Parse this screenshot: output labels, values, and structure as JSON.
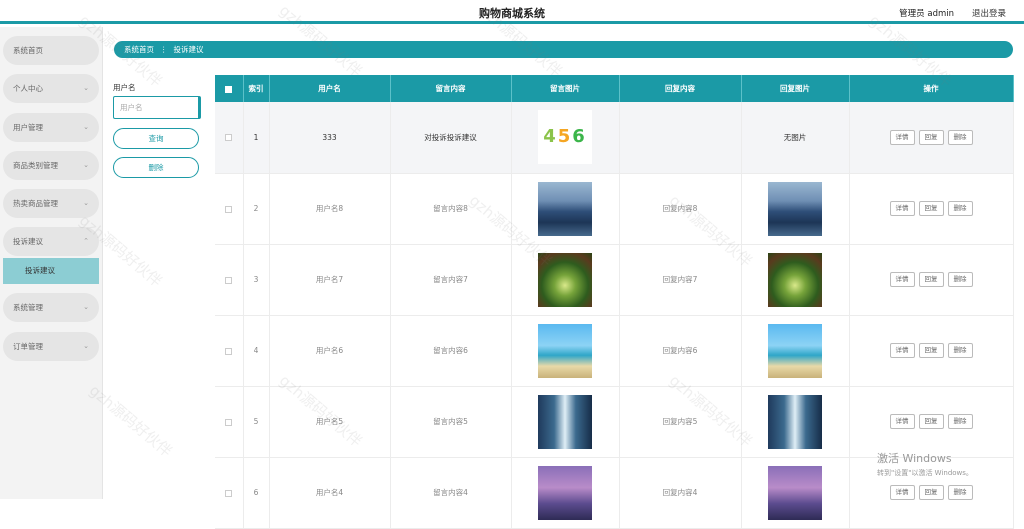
{
  "header": {
    "title": "购物商城系统",
    "admin": "管理员 admin",
    "logout": "退出登录"
  },
  "sidebar": {
    "items": [
      {
        "label": "系统首页",
        "chevron": ""
      },
      {
        "label": "个人中心",
        "chevron": "⌄"
      },
      {
        "label": "用户管理",
        "chevron": "⌄"
      },
      {
        "label": "商品类别管理",
        "chevron": "⌄"
      },
      {
        "label": "热卖商品管理",
        "chevron": "⌄"
      },
      {
        "label": "投诉建议",
        "chevron": "⌃"
      },
      {
        "label": "系统管理",
        "chevron": "⌄"
      },
      {
        "label": "订单管理",
        "chevron": "⌄"
      }
    ],
    "submenu": "投诉建议"
  },
  "breadcrumb": {
    "home": "系统首页",
    "separator": "⋮",
    "current": "投诉建议"
  },
  "filter": {
    "label": "用户名",
    "placeholder": "用户名",
    "query": "查询",
    "delete": "删除"
  },
  "table": {
    "headers": [
      "索引",
      "用户名",
      "留言内容",
      "留言图片",
      "回复内容",
      "回复图片",
      "操作"
    ],
    "rows": [
      {
        "index": "1",
        "user": "333",
        "content": "对投诉投诉建议",
        "reply": "",
        "reply_img_text": "无图片",
        "img": "captcha",
        "captcha": [
          "4",
          "5",
          "6"
        ]
      },
      {
        "index": "2",
        "user": "用户名8",
        "content": "留言内容8",
        "reply": "回复内容8",
        "img": "lake"
      },
      {
        "index": "3",
        "user": "用户名7",
        "content": "留言内容7",
        "reply": "回复内容7",
        "img": "forest"
      },
      {
        "index": "4",
        "user": "用户名6",
        "content": "留言内容6",
        "reply": "回复内容6",
        "img": "beach"
      },
      {
        "index": "5",
        "user": "用户名5",
        "content": "留言内容5",
        "reply": "回复内容5",
        "img": "fall"
      },
      {
        "index": "6",
        "user": "用户名4",
        "content": "留言内容4",
        "reply": "回复内容4",
        "img": "sunset"
      }
    ],
    "actions": {
      "detail": "详情",
      "reply": "回复",
      "delete": "删除"
    }
  },
  "watermark": "gzh源码好伙伴",
  "activation": {
    "line1": "激活 Windows",
    "line2": "转到\"设置\"以激活 Windows。"
  },
  "colors": {
    "accent": "#1b9aa6"
  }
}
